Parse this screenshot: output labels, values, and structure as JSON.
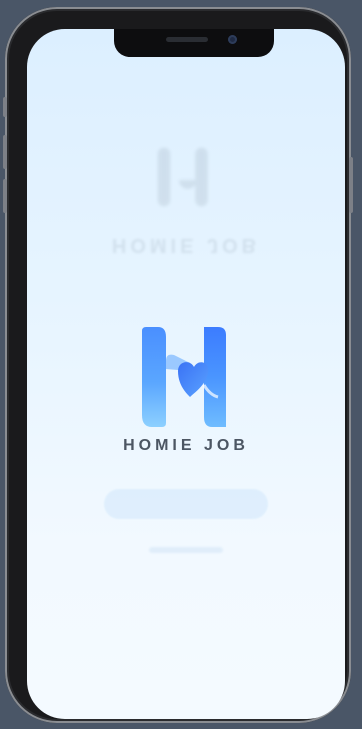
{
  "app": {
    "title": "HOMIE JOB"
  },
  "splash": {
    "logo_icon": "homie-job-h-logo",
    "brand_colors": {
      "primary_blue": "#3f8bff",
      "light_blue": "#7dc2ff",
      "title_gray": "#4c5663"
    }
  },
  "device": {
    "frame": "iphone-notch"
  }
}
